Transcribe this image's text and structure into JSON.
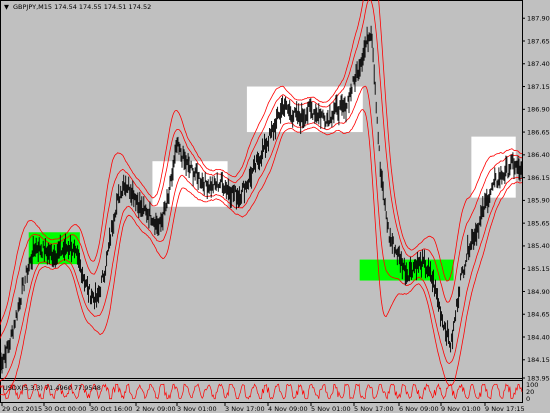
{
  "window": {
    "symbol_line": "GBPJPY,M15  174.54 174.55 174.51 174.52"
  },
  "indicator": {
    "label": "USDX(5,3,3) 71.4960 77.9548",
    "scale_top": "100",
    "scale_mid": "20",
    "scale_bot": "0"
  },
  "colors": {
    "background": "#c0c0c0",
    "candles": "#000000",
    "bands": "#ff0000",
    "zone_green": "#00ff00",
    "zone_white": "#ffffff"
  },
  "chart_data": {
    "type": "line",
    "title": "GBPJPY,M15",
    "ylim": [
      183.95,
      188.1
    ],
    "y_ticks": [
      "187.90",
      "187.65",
      "187.40",
      "187.15",
      "186.90",
      "186.65",
      "186.40",
      "186.15",
      "185.90",
      "185.65",
      "185.40",
      "185.15",
      "184.90",
      "184.65",
      "184.40",
      "184.15",
      "183.95"
    ],
    "x_ticks": [
      "29 Oct 2015",
      "30 Oct 00:00",
      "30 Oct 16:00",
      "2 Nov 09:00",
      "3 Nov 01:00",
      "3 Nov 17:00",
      "4 Nov 09:00",
      "5 Nov 01:00",
      "5 Nov 17:00",
      "6 Nov 09:00",
      "9 Nov 01:00",
      "9 Nov 17:15"
    ],
    "series": [
      {
        "name": "price",
        "values": [
          184.1,
          184.3,
          184.7,
          185.1,
          185.4,
          185.35,
          185.3,
          185.35,
          185.4,
          185.2,
          184.9,
          184.8,
          185.2,
          185.8,
          186.1,
          186.0,
          185.8,
          185.75,
          185.6,
          185.9,
          186.5,
          186.3,
          186.2,
          186.1,
          186.05,
          186.1,
          186.0,
          185.95,
          186.1,
          186.3,
          186.5,
          186.7,
          186.95,
          186.85,
          186.8,
          186.9,
          186.85,
          186.8,
          186.9,
          186.9,
          187.2,
          187.5,
          187.8,
          186.2,
          185.5,
          185.3,
          185.1,
          185.2,
          185.2,
          185.0,
          184.6,
          184.3,
          185.0,
          185.4,
          185.6,
          185.9,
          186.1,
          186.2,
          186.3,
          186.2
        ]
      }
    ],
    "zones": [
      {
        "color": "green",
        "x0": 0.055,
        "x1": 0.153,
        "y0": 185.55,
        "y1": 185.2
      },
      {
        "color": "white",
        "x0": 0.292,
        "x1": 0.436,
        "y0": 186.33,
        "y1": 185.83
      },
      {
        "color": "white",
        "x0": 0.473,
        "x1": 0.695,
        "y0": 187.15,
        "y1": 186.65
      },
      {
        "color": "green",
        "x0": 0.689,
        "x1": 0.869,
        "y0": 185.25,
        "y1": 185.02
      },
      {
        "color": "white",
        "x0": 0.903,
        "x1": 0.988,
        "y0": 186.6,
        "y1": 185.93
      }
    ]
  }
}
